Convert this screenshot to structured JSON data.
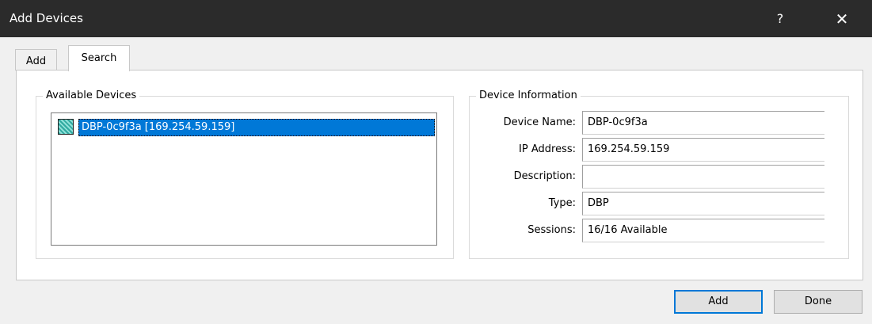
{
  "window": {
    "title": "Add Devices",
    "help_glyph": "?",
    "close_glyph": "✕"
  },
  "tabs": [
    {
      "label": "Add"
    },
    {
      "label": "Search"
    }
  ],
  "available_devices": {
    "group_label": "Available Devices",
    "items": [
      {
        "label": "DBP-0c9f3a [169.254.59.159]",
        "selected": true
      }
    ]
  },
  "device_information": {
    "group_label": "Device Information",
    "fields": [
      {
        "label": "Device Name:",
        "value": "DBP-0c9f3a"
      },
      {
        "label": "IP Address:",
        "value": "169.254.59.159"
      },
      {
        "label": "Description:",
        "value": ""
      },
      {
        "label": "Type:",
        "value": "DBP"
      },
      {
        "label": "Sessions:",
        "value": "16/16 Available"
      }
    ]
  },
  "buttons": {
    "add_label": "Add",
    "done_label": "Done"
  },
  "colors": {
    "selection": "#0078d7",
    "titlebar": "#2b2b2b",
    "default_button_border": "#0078d7"
  },
  "icons": {
    "device_item": "device-icon"
  }
}
